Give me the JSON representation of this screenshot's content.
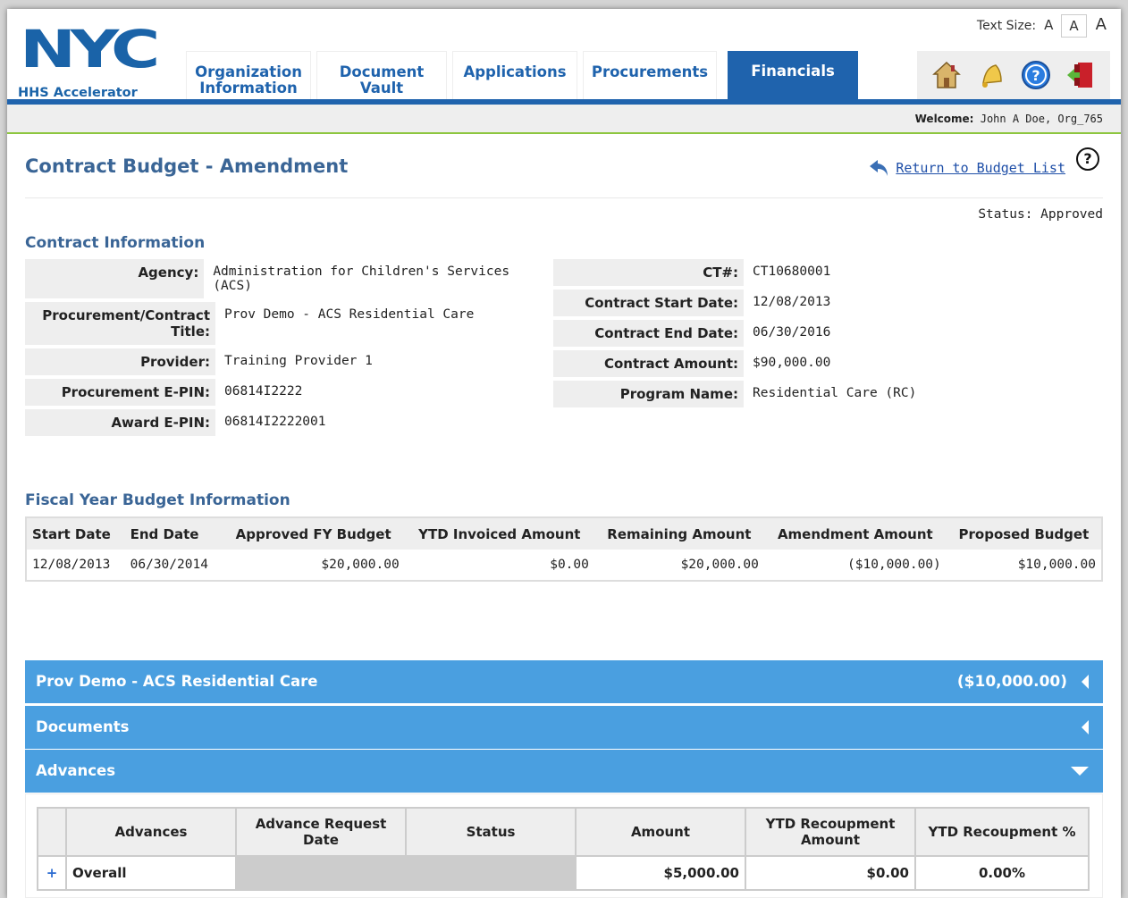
{
  "header": {
    "logo_text": "NYC",
    "logo_subtitle": "HHS Accelerator",
    "text_size_label": "Text Size:",
    "text_size_options": [
      "A",
      "A",
      "A"
    ],
    "tabs": [
      {
        "label": "Organization Information"
      },
      {
        "label": "Document Vault"
      },
      {
        "label": "Applications"
      },
      {
        "label": "Procurements"
      },
      {
        "label": "Financials"
      }
    ],
    "active_tab": "Financials",
    "icons": [
      "home-icon",
      "bell-icon",
      "help-icon",
      "logout-icon"
    ],
    "welcome_label": "Welcome:",
    "welcome_user": "John A Doe, Org_765"
  },
  "page": {
    "title": "Contract Budget - Amendment",
    "return_link": "Return to Budget List",
    "status": "Status: Approved"
  },
  "contract_info": {
    "section_title": "Contract Information",
    "left": [
      {
        "label": "Agency:",
        "value": "Administration for Children's Services (ACS)"
      },
      {
        "label": "Procurement/Contract Title:",
        "value": "Prov Demo - ACS Residential Care"
      },
      {
        "label": "Provider:",
        "value": "Training Provider 1"
      },
      {
        "label": "Procurement E-PIN:",
        "value": "06814I2222"
      },
      {
        "label": "Award E-PIN:",
        "value": "06814I2222001"
      }
    ],
    "right": [
      {
        "label": "CT#:",
        "value": "CT10680001"
      },
      {
        "label": "Contract Start Date:",
        "value": "12/08/2013"
      },
      {
        "label": "Contract End Date:",
        "value": "06/30/2016"
      },
      {
        "label": "Contract Amount:",
        "value": "$90,000.00"
      },
      {
        "label": "Program Name:",
        "value": "Residential Care (RC)"
      }
    ]
  },
  "fiscal": {
    "section_title": "Fiscal Year Budget Information",
    "headers": [
      "Start Date",
      "End Date",
      "Approved FY Budget",
      "YTD Invoiced Amount",
      "Remaining Amount",
      "Amendment Amount",
      "Proposed Budget"
    ],
    "rows": [
      [
        "12/08/2013",
        "06/30/2014",
        "$20,000.00",
        "$0.00",
        "$20,000.00",
        "($10,000.00)",
        "$10,000.00"
      ]
    ]
  },
  "accordions": [
    {
      "title": "Prov Demo - ACS Residential Care",
      "amount": "($10,000.00)",
      "state": "collapsed"
    },
    {
      "title": "Documents",
      "amount": "",
      "state": "collapsed"
    },
    {
      "title": "Advances",
      "amount": "",
      "state": "expanded"
    }
  ],
  "advances": {
    "headers": [
      "",
      "Advances",
      "Advance Request Date",
      "Status",
      "Amount",
      "YTD Recoupment Amount",
      "YTD Recoupment %"
    ],
    "rows": [
      {
        "expand": "+",
        "name": "Overall",
        "request_date": "",
        "status": "",
        "amount": "$5,000.00",
        "ytd_amount": "$0.00",
        "ytd_pct": "0.00%"
      }
    ]
  },
  "colors": {
    "brand_blue": "#1f63ad",
    "accordion_blue": "#4a9fe0",
    "title_blue": "#3a6596",
    "green_rule": "#8dc63f"
  }
}
